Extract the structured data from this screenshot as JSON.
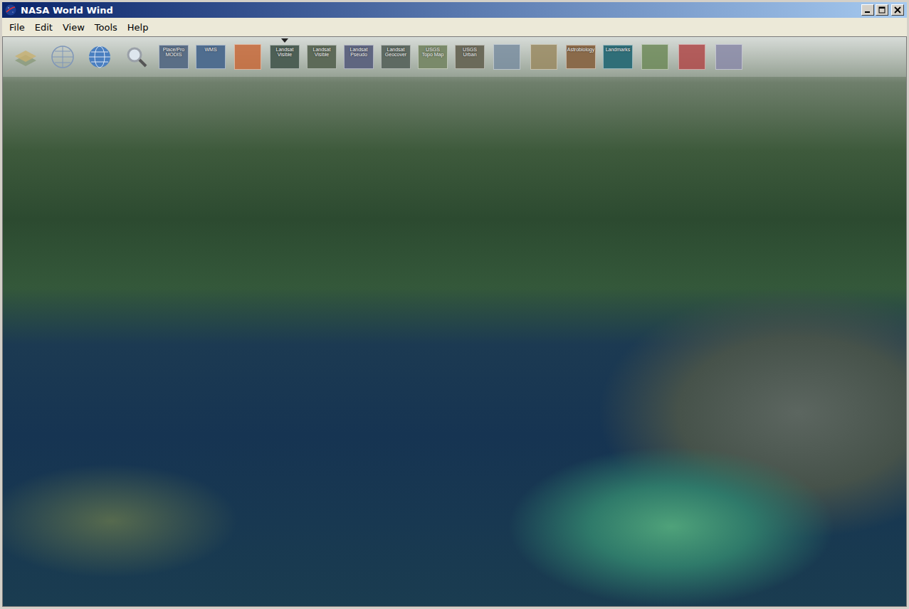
{
  "window": {
    "title": "NASA World Wind"
  },
  "menu": [
    "File",
    "Edit",
    "View",
    "Tools",
    "Help"
  ],
  "toolbar": [
    {
      "kind": "layers",
      "label": "",
      "color": "#8a9a7a",
      "selected": false
    },
    {
      "kind": "grid",
      "label": "",
      "color": "#7f96b8",
      "selected": false
    },
    {
      "kind": "globe",
      "label": "",
      "color": "#4a7fc0",
      "selected": false
    },
    {
      "kind": "search",
      "label": "",
      "color": "#9aa0a8",
      "selected": false
    },
    {
      "kind": "tile",
      "label": "Place/Pro MODIS",
      "color": "#5a6e86",
      "selected": false
    },
    {
      "kind": "tile",
      "label": "WMS",
      "color": "#4f6d8f",
      "selected": false
    },
    {
      "kind": "picture",
      "label": "",
      "color": "#c86a3a",
      "selected": false
    },
    {
      "kind": "tile",
      "label": "Landsat Visible",
      "color": "#4d5f55",
      "selected": true
    },
    {
      "kind": "tile",
      "label": "Landsat Visible",
      "color": "#5d6a58",
      "selected": false
    },
    {
      "kind": "tile",
      "label": "Landsat Pseudo",
      "color": "#5f6680",
      "selected": false
    },
    {
      "kind": "tile",
      "label": "Landsat Geocover",
      "color": "#5e6a62",
      "selected": false
    },
    {
      "kind": "tile",
      "label": "USGS Topo Map",
      "color": "#7a8a6a",
      "selected": false
    },
    {
      "kind": "tile",
      "label": "USGS Urban",
      "color": "#6b6a5a",
      "selected": false
    },
    {
      "kind": "picture",
      "label": "",
      "color": "#7a8ea0",
      "selected": false
    },
    {
      "kind": "picture",
      "label": "",
      "color": "#9a8a62",
      "selected": false
    },
    {
      "kind": "tile",
      "label": "Astrobiology",
      "color": "#8a6a4a",
      "selected": false
    },
    {
      "kind": "tile",
      "label": "Landmarks",
      "color": "#2f6e78",
      "selected": false
    },
    {
      "kind": "picture",
      "label": "",
      "color": "#6e8a5a",
      "selected": false
    },
    {
      "kind": "picture",
      "label": "",
      "color": "#b04a4a",
      "selected": false
    },
    {
      "kind": "picture",
      "label": "",
      "color": "#8a8aa8",
      "selected": false
    }
  ]
}
